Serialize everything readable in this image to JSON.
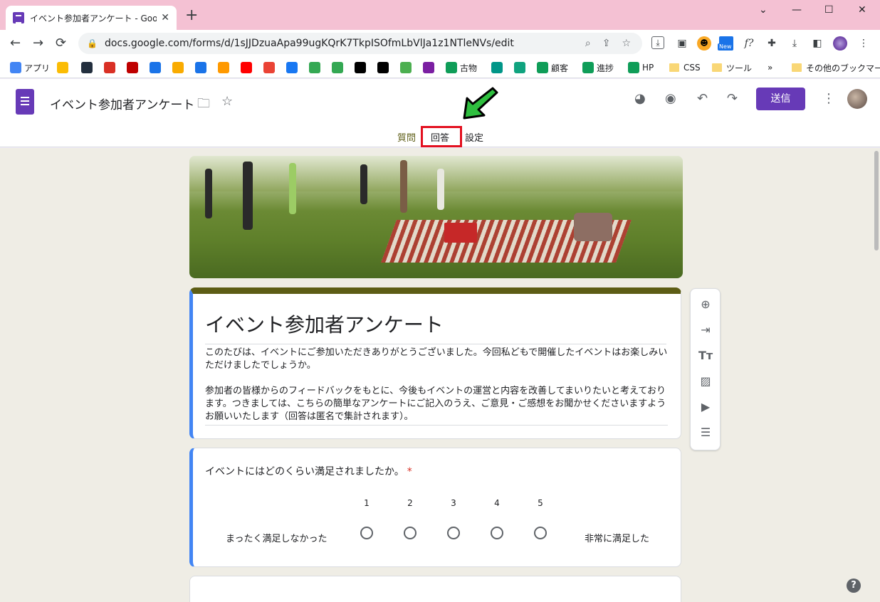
{
  "browser": {
    "tab_title": "イベント参加者アンケート - Google フ",
    "tab_close": "✕",
    "new_tab": "+",
    "url": "docs.google.com/forms/d/1sJJDzuaApa99ugKQrK7TkpISOfmLbVlJa1z1NTleNVs/edit",
    "window_controls": [
      "⌄",
      "—",
      "☐",
      "✕"
    ],
    "nav": {
      "back": "←",
      "forward": "→",
      "reload": "⟳"
    },
    "new_badge": "New",
    "fx_ext": "f?"
  },
  "bookmarks": [
    {
      "label": "アプリ",
      "icon": "apps-grid-icon",
      "color": "#4285f4"
    },
    {
      "label": "",
      "icon": "google-ads-icon",
      "color": "#fbbc04"
    },
    {
      "label": "",
      "icon": "amazon-icon",
      "color": "#232f3e"
    },
    {
      "label": "",
      "icon": "a8-icon",
      "color": "#d93025"
    },
    {
      "label": "",
      "icon": "rakuten-icon",
      "color": "#bf0000"
    },
    {
      "label": "",
      "icon": "vc-icon",
      "color": "#1a73e8"
    },
    {
      "label": "",
      "icon": "analytics-icon",
      "color": "#f9ab00"
    },
    {
      "label": "",
      "icon": "arrow-icon",
      "color": "#1a73e8"
    },
    {
      "label": "",
      "icon": "amazon-icon",
      "color": "#ff9900"
    },
    {
      "label": "",
      "icon": "youtube-icon",
      "color": "#ff0000"
    },
    {
      "label": "",
      "icon": "gmail-icon",
      "color": "#ea4335"
    },
    {
      "label": "",
      "icon": "facebook-icon",
      "color": "#1877f2"
    },
    {
      "label": "",
      "icon": "hatena-icon",
      "color": "#34a853"
    },
    {
      "label": "",
      "icon": "maps-icon",
      "color": "#34a853"
    },
    {
      "label": "",
      "icon": "x-icon",
      "color": "#000000"
    },
    {
      "label": "",
      "icon": "is-icon",
      "color": "#000000"
    },
    {
      "label": "",
      "icon": "px-icon",
      "color": "#4caf50"
    },
    {
      "label": "",
      "icon": "character-icon",
      "color": "#7b1fa2"
    },
    {
      "label": "古物",
      "icon": "sheets-icon",
      "color": "#0f9d58"
    },
    {
      "label": "",
      "icon": "aa-icon",
      "color": "#009688"
    },
    {
      "label": "",
      "icon": "chatgpt-icon",
      "color": "#10a37f"
    },
    {
      "label": "顧客",
      "icon": "sheets-icon",
      "color": "#0f9d58"
    },
    {
      "label": "進捗",
      "icon": "sheets-icon",
      "color": "#0f9d58"
    },
    {
      "label": "HP",
      "icon": "sheets-icon",
      "color": "#0f9d58"
    },
    {
      "label": "CSS",
      "icon": "folder-icon",
      "color": "#f9d776"
    },
    {
      "label": "ツール",
      "icon": "folder-icon",
      "color": "#f9d776"
    }
  ],
  "bookmarks_more": "»",
  "bookmarks_other": "その他のブックマーク",
  "form_header": {
    "doc_title": "イベント参加者アンケート",
    "send_label": "送信",
    "tabs": [
      {
        "label": "質問",
        "active": true
      },
      {
        "label": "回答",
        "active": false
      },
      {
        "label": "設定",
        "active": false
      }
    ]
  },
  "form": {
    "title": "イベント参加者アンケート",
    "description": [
      "このたびは、イベントにご参加いただきありがとうございました。今回私どもで開催したイベントはお楽しみいただけましたでしょうか。",
      "参加者の皆様からのフィードバックをもとに、今後もイベントの運営と内容を改善してまいりたいと考えております。つきましては、こちらの簡単なアンケートにご記入のうえ、ご意見・ご感想をお聞かせくださいますようお願いいたします（回答は匿名で集計されます）。"
    ],
    "question": {
      "text": "イベントにはどのくらい満足されましたか。",
      "required_mark": "*",
      "scale": [
        "1",
        "2",
        "3",
        "4",
        "5"
      ],
      "low_label": "まったく満足しなかった",
      "high_label": "非常に満足した"
    }
  },
  "help": "?",
  "colors": {
    "accent": "#673ab7",
    "theme": "#5d5d15",
    "highlight": "#e3101f",
    "arrow": "#2fbf3f"
  }
}
